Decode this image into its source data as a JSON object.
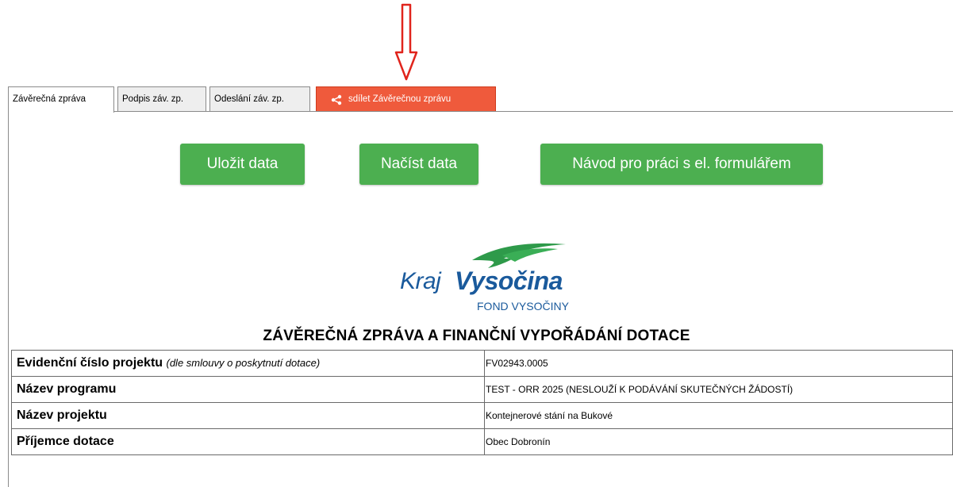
{
  "tabs": [
    {
      "label": "Závěrečná zpráva",
      "active": true
    },
    {
      "label": "Podpis záv. zp.",
      "active": false
    },
    {
      "label": "Odeslání záv. zp.",
      "active": false
    },
    {
      "label": "sdílet Závěrečnou zprávu",
      "active": false,
      "icon": "share-icon"
    }
  ],
  "buttons": {
    "save": "Uložit data",
    "load": "Načíst data",
    "guide": "Návod pro práci s el. formulářem"
  },
  "logo": {
    "kraj": "Kraj",
    "vysocina": "Vysočina",
    "fond": "FOND VYSOČINY"
  },
  "document": {
    "title": "ZÁVĚREČNÁ ZPRÁVA A FINANČNÍ VYPOŘÁDÁNÍ DOTACE"
  },
  "rows": [
    {
      "label": "Evidenční číslo projektu",
      "note": "(dle smlouvy o poskytnutí dotace)",
      "value": "FV02943.0005"
    },
    {
      "label": "Název programu",
      "note": "",
      "value": "TEST - ORR 2025 (NESLOUŽÍ K PODÁVÁNÍ SKUTEČNÝCH ŽÁDOSTÍ)"
    },
    {
      "label": "Název projektu",
      "note": "",
      "value": "Kontejnerové stání na Bukové"
    },
    {
      "label": "Příjemce dotace",
      "note": "",
      "value": "Obec Dobronín"
    }
  ],
  "colors": {
    "accent_green": "#4caf50",
    "share_tab": "#ef5a3c",
    "annotation_arrow": "#e0241c",
    "logo_blue": "#1a5a9c",
    "logo_green": "#2e9a4a"
  }
}
